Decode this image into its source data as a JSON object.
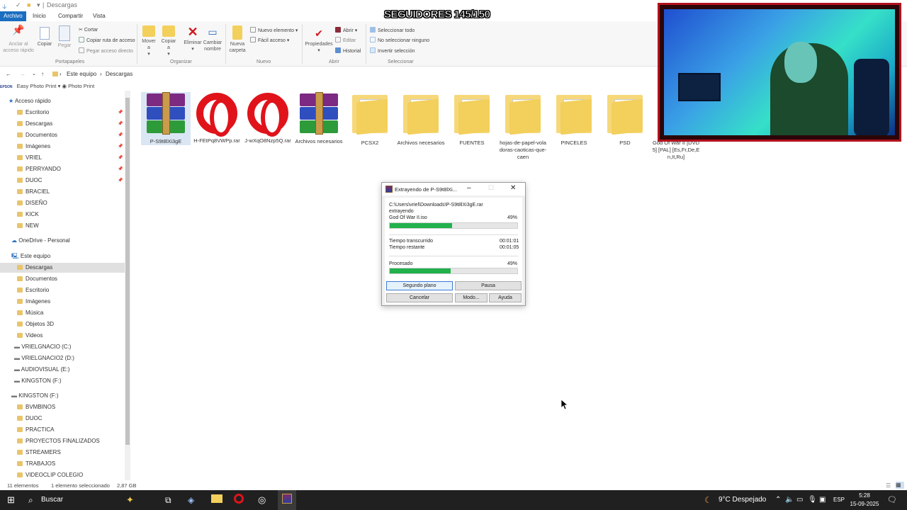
{
  "window": {
    "title": "Descargas"
  },
  "ribbon_tabs": [
    "Archivo",
    "Inicio",
    "Compartir",
    "Vista"
  ],
  "ribbon": {
    "portapapeles": {
      "pin": "Anclar al acceso rápido",
      "copy": "Copiar",
      "paste": "Pegar",
      "cut": "Cortar",
      "copy_path": "Copiar ruta de acceso",
      "paste_shortcut": "Pegar acceso directo",
      "group": "Portapapeles"
    },
    "organizar": {
      "move": "Mover a",
      "copy": "Copiar a",
      "delete": "Eliminar",
      "rename": "Cambiar nombre",
      "group": "Organizar"
    },
    "nuevo": {
      "new_folder": "Nueva carpeta",
      "new_item": "Nuevo elemento",
      "easy_access": "Fácil acceso",
      "group": "Nuevo"
    },
    "abrir": {
      "properties": "Propiedades",
      "open": "Abrir",
      "edit": "Editar",
      "history": "Historial",
      "group": "Abrir"
    },
    "seleccionar": {
      "select_all": "Seleccionar todo",
      "select_none": "No seleccionar ninguno",
      "invert": "Invertir selección",
      "group": "Seleccionar"
    }
  },
  "address": {
    "part1": "Este equipo",
    "part2": "Descargas"
  },
  "favbar": {
    "item1": "Easy Photo Print",
    "item2": "Photo Print",
    "logo": "EPSON"
  },
  "nav": {
    "quick_access": "Acceso rápido",
    "quick": [
      "Escritorio",
      "Descargas",
      "Documentos",
      "Imágenes",
      "VRIEL",
      "PERRYANDO",
      "DUOC",
      "BRACIEL",
      "DISEÑO",
      "KICK",
      "NEW"
    ],
    "onedrive": "OneDrive - Personal",
    "this_pc": "Este equipo",
    "pc": [
      "Descargas",
      "Documentos",
      "Escritorio",
      "Imágenes",
      "Música",
      "Objetos 3D",
      "Videos",
      "VRIELGNACIO (C:)",
      "VRIELGNACIO2 (D:)",
      "AUDIOVISUAL (E:)",
      "KINGSTON (F:)"
    ],
    "kingston": "KINGSTON (F:)",
    "kingston_items": [
      "BVMBINOS",
      "DUOC",
      "PRACTICA",
      "PROYECTOS FINALIZADOS",
      "STREAMERS",
      "TRABAJOS",
      "VIDEOCLIP COLEGIO"
    ]
  },
  "files": [
    {
      "name": "P-S9t8lXi3gE",
      "type": "rar"
    },
    {
      "name": "H-FEtPq8VWPp.rar",
      "type": "opera"
    },
    {
      "name": "J-wXqO8Nzp5Q.rar",
      "type": "opera"
    },
    {
      "name": "Archivos necesarios",
      "type": "rar"
    },
    {
      "name": "PCSX2",
      "type": "folder"
    },
    {
      "name": "Archivos necesarios",
      "type": "folder"
    },
    {
      "name": "FUENTES",
      "type": "folder"
    },
    {
      "name": "hojas-de-papel-voladoras-caoticas-que-caen",
      "type": "folder"
    },
    {
      "name": "PINCELES",
      "type": "folder"
    },
    {
      "name": "PSD",
      "type": "folder"
    },
    {
      "name": "God Of War II [DVD5] [PAL] [Es,Fr,De,En,It,Ru]",
      "type": "folder"
    }
  ],
  "overlay": {
    "followers": "SEGUIDORES 145/150"
  },
  "dialog": {
    "title": "Extrayendo de P-S9t8lXi...",
    "path": "C:\\Users\\vriel\\Downloads\\P-S9t8lXi3gE.rar",
    "status": "extrayendo",
    "file": "God Of War II.iso",
    "file_percent": "49%",
    "file_progress": 0.49,
    "elapsed_label": "Tiempo transcurrido",
    "elapsed": "00:01:01",
    "remaining_label": "Tiempo restante",
    "remaining": "00:01:05",
    "processed_label": "Procesado",
    "processed_percent": "49%",
    "processed_progress": 0.48,
    "btn_background": "Segundo plano",
    "btn_pause": "Pausa",
    "btn_cancel": "Cancelar",
    "btn_mode": "Modo...",
    "btn_help": "Ayuda"
  },
  "status": {
    "count": "11 elementos",
    "selected": "1 elemento seleccionado",
    "size": "2,87 GB"
  },
  "taskbar": {
    "search": "Buscar",
    "weather": "9°C Despejado",
    "lang": "ESP",
    "time": "5:28",
    "date": "15-09-2025"
  },
  "colors": {
    "accent": "#1a6dc1",
    "progress": "#22b14c",
    "taskbar": "#202020",
    "overlay_border": "#b3121e"
  }
}
